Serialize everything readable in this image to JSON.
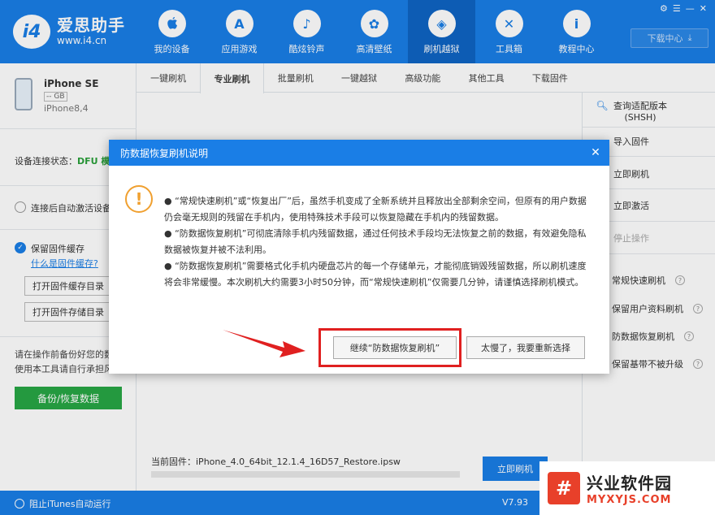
{
  "app": {
    "logo_mark": "i4",
    "logo_cn": "爱思助手",
    "logo_url": "www.i4.cn",
    "download_center": "下载中心"
  },
  "nav": [
    {
      "label": "我的设备",
      "icon": "apple-icon",
      "glyph": ""
    },
    {
      "label": "应用游戏",
      "icon": "appstore-icon",
      "glyph": "A"
    },
    {
      "label": "酷炫铃声",
      "icon": "bell-icon",
      "glyph": "♪"
    },
    {
      "label": "高清壁纸",
      "icon": "flower-icon",
      "glyph": "✿"
    },
    {
      "label": "刷机越狱",
      "icon": "box-icon",
      "glyph": "◈"
    },
    {
      "label": "工具箱",
      "icon": "tools-icon",
      "glyph": "✕"
    },
    {
      "label": "教程中心",
      "icon": "info-icon",
      "glyph": "i"
    }
  ],
  "tabs": [
    "一键刷机",
    "专业刷机",
    "批量刷机",
    "一键越狱",
    "高级功能",
    "其他工具",
    "下载固件"
  ],
  "device": {
    "name": "iPhone SE",
    "capacity": "-- GB",
    "model": "iPhone8,4"
  },
  "left": {
    "conn_label": "设备连接状态：",
    "conn_value": "DFU 模",
    "auto_activate": "连接后自动激活设备",
    "keep_cache": "保留固件缓存",
    "what_cache": "什么是固件缓存?",
    "open_cache_dir": "打开固件缓存目录",
    "open_store_dir": "打开固件存储目录",
    "note_line1": "请在操作前备份好您的数",
    "note_line2": "使用本工具请自行承担风",
    "backup_btn": "备份/恢复数据"
  },
  "right": {
    "shsh": "查询适配版本",
    "shsh2": "(SHSH)",
    "import": "导入固件",
    "flash_now": "立即刷机",
    "activate_now": "立即激活",
    "stop": "停止操作",
    "normal_flash": "常规快速刷机",
    "keep_user_data": "保留用户资料刷机",
    "anti_recovery": "防数据恢复刷机",
    "keep_baseband": "保留基带不被升级"
  },
  "bottom": {
    "firmware_label": "当前固件：",
    "firmware_value": "iPhone_4.0_64bit_12.1.4_16D57_Restore.ipsw",
    "flash_btn": "立即刷机"
  },
  "status": {
    "block_itunes": "阻止iTunes自动运行",
    "version": "V7.93"
  },
  "dialog": {
    "title": "防数据恢复刷机说明",
    "close": "✕",
    "para1": "●  “常规快速刷机”或“恢复出厂”后，虽然手机变成了全新系统并且释放出全部剩余空间，但原有的用户数据仍会毫无规则的残留在手机内，使用特殊技术手段可以恢复隐藏在手机内的残留数据。",
    "para2": "●  “防数据恢复刷机”可彻底清除手机内残留数据，通过任何技术手段均无法恢复之前的数据，有效避免隐私数据被恢复并被不法利用。",
    "para3": "●  “防数据恢复刷机”需要格式化手机内硬盘芯片的每一个存储单元，才能彻底销毁残留数据，所以刷机速度将会非常缓慢。本次刷机大约需要3小时50分钟，而“常规快速刷机”仅需要几分钟，请谨慎选择刷机模式。",
    "continue_btn": "继续“防数据恢复刷机”",
    "cancel_btn": "太慢了，我要重新选择"
  },
  "watermark": {
    "mark": "#",
    "cn": "兴业软件园",
    "en": "MYXYJS.COM"
  },
  "colors": {
    "brand": "#1a7ee6",
    "highlight": "#e02020",
    "success": "#28a745",
    "warning": "#f0a030"
  }
}
